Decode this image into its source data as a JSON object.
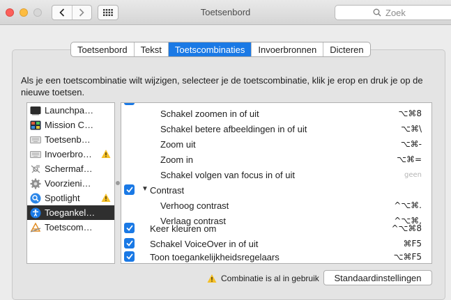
{
  "window": {
    "title": "Toetsenbord",
    "search_placeholder": "Zoek"
  },
  "tabs": [
    {
      "label": "Toetsenbord",
      "active": false
    },
    {
      "label": "Tekst",
      "active": false
    },
    {
      "label": "Toetscombinaties",
      "active": true
    },
    {
      "label": "Invoerbronnen",
      "active": false
    },
    {
      "label": "Dicteren",
      "active": false
    }
  ],
  "description": "Als je een toetscombinatie wilt wijzigen, selecteer je de toetscombinatie, klik je erop en druk je op de nieuwe toetsen.",
  "sidebar": {
    "items": [
      {
        "label": "Launchpa…",
        "icon": "launchpad-icon",
        "warning": false,
        "selected": false
      },
      {
        "label": "Mission C…",
        "icon": "mission-control-icon",
        "warning": false,
        "selected": false
      },
      {
        "label": "Toetsenb…",
        "icon": "keyboard-icon",
        "warning": false,
        "selected": false
      },
      {
        "label": "Invoerbro…",
        "icon": "input-sources-icon",
        "warning": true,
        "selected": false
      },
      {
        "label": "Schermaf…",
        "icon": "screenshot-icon",
        "warning": false,
        "selected": false
      },
      {
        "label": "Voorzieni…",
        "icon": "services-gear-icon",
        "warning": false,
        "selected": false
      },
      {
        "label": "Spotlight",
        "icon": "spotlight-icon",
        "warning": true,
        "selected": false
      },
      {
        "label": "Toegankel…",
        "icon": "accessibility-icon",
        "warning": false,
        "selected": true
      },
      {
        "label": "Toetscom…",
        "icon": "app-shortcuts-icon",
        "warning": false,
        "selected": false
      }
    ]
  },
  "shortcuts": [
    {
      "label": "Schakel zoomen in of uit",
      "key": "⌥⌘8",
      "indent": 2,
      "checkbox": false,
      "muted": false
    },
    {
      "label": "Schakel betere afbeeldingen in of uit",
      "key": "⌥⌘\\",
      "indent": 2,
      "checkbox": false,
      "muted": false
    },
    {
      "label": "Zoom uit",
      "key": "⌥⌘-",
      "indent": 2,
      "checkbox": false,
      "muted": false
    },
    {
      "label": "Zoom in",
      "key": "⌥⌘=",
      "indent": 2,
      "checkbox": false,
      "muted": false
    },
    {
      "label": "Schakel volgen van focus in of uit",
      "key": "geen",
      "indent": 2,
      "checkbox": false,
      "muted": true
    },
    {
      "label": "Contrast",
      "key": "",
      "indent": 1,
      "checkbox": true,
      "disclosure": "▼",
      "muted": false
    },
    {
      "label": "Verhoog contrast",
      "key": "^⌥⌘.",
      "indent": 2,
      "checkbox": false,
      "muted": false
    },
    {
      "label": "Verlaag contrast",
      "key": "^⌥⌘,",
      "indent": 2,
      "checkbox": false,
      "muted": false
    },
    {
      "label": "Keer kleuren om",
      "key": "^⌥⌘8",
      "indent": 0,
      "checkbox": true,
      "muted": false
    },
    {
      "label": "Schakel VoiceOver in of uit",
      "key": "⌘F5",
      "indent": 0,
      "checkbox": true,
      "muted": false
    },
    {
      "label": "Toon toegankelijkheidsregelaars",
      "key": "⌥⌘F5",
      "indent": 0,
      "checkbox": true,
      "muted": false
    }
  ],
  "footer": {
    "conflict_text": "Combinatie is al in gebruik",
    "defaults_label": "Standaardinstellingen"
  }
}
